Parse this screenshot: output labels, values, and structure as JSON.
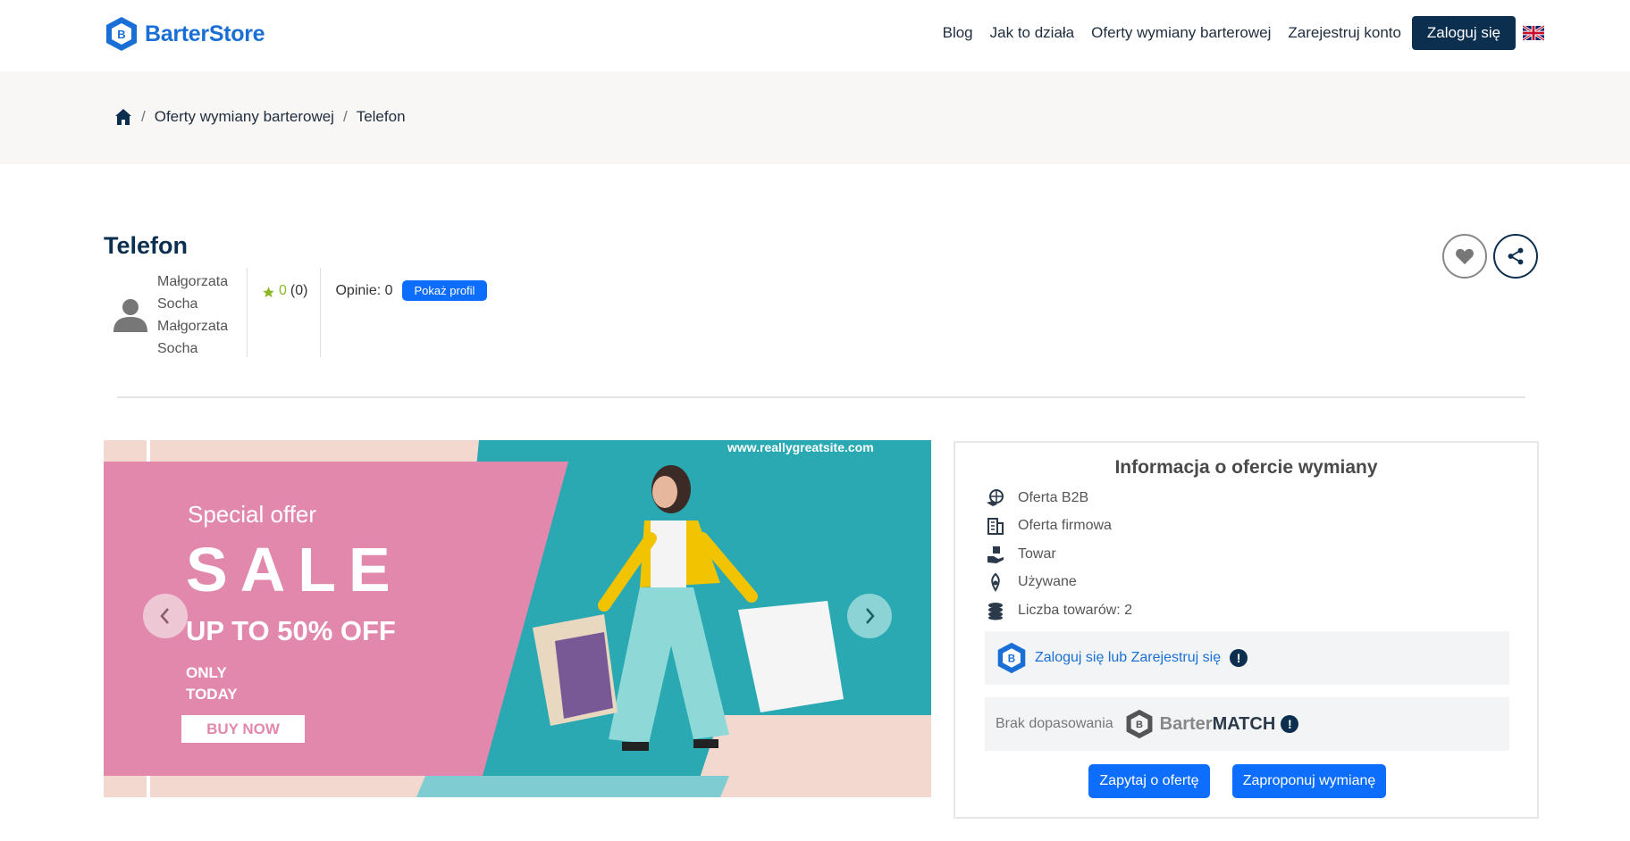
{
  "header": {
    "brand": "BarterStore",
    "nav": [
      "Blog",
      "Jak to działa",
      "Oferty wymiany barterowej",
      "Zarejestruj konto"
    ],
    "login_label": "Zaloguj się",
    "language_icon": "uk-flag-icon"
  },
  "breadcrumb": {
    "home_icon": "home-icon",
    "items": [
      "Oferty wymiany barterowej",
      "Telefon"
    ]
  },
  "offer": {
    "title": "Telefon",
    "user_name_line1": "Małgorzata Socha",
    "user_name_line2": "Małgorzata Socha",
    "rating_value": "0",
    "rating_count": "(0)",
    "opinions": "Opinie: 0",
    "show_profile": "Pokaż profil"
  },
  "banner": {
    "site": "www.reallygreatsite.com",
    "special": "Special offer",
    "sale": "SALE",
    "discount": "UP TO 50% OFF",
    "only": "ONLY",
    "today": "TODAY",
    "cta": "BUY NOW"
  },
  "info": {
    "title": "Informacja o ofercie wymiany",
    "items": [
      {
        "icon": "handshake-globe-icon",
        "label": "Oferta B2B"
      },
      {
        "icon": "building-icon",
        "label": "Oferta firmowa"
      },
      {
        "icon": "hand-box-icon",
        "label": "Towar"
      },
      {
        "icon": "recycle-icon",
        "label": "Używane"
      },
      {
        "icon": "coins-stack-icon",
        "label": "Liczba towarów: 2"
      }
    ],
    "login_prompt": "Zaloguj się lub Zarejestruj się",
    "no_match": "Brak dopasowania",
    "match_brand_1": "Barter",
    "match_brand_2": "MATCH",
    "ask_button": "Zapytaj o ofertę",
    "propose_button": "Zaproponuj wymianę"
  },
  "colors": {
    "navy": "#0d2f4f",
    "primary": "#0d6efd",
    "brand_blue": "#1a6fd6",
    "banner_pink": "#e288ac",
    "banner_teal": "#2aa9b3"
  }
}
